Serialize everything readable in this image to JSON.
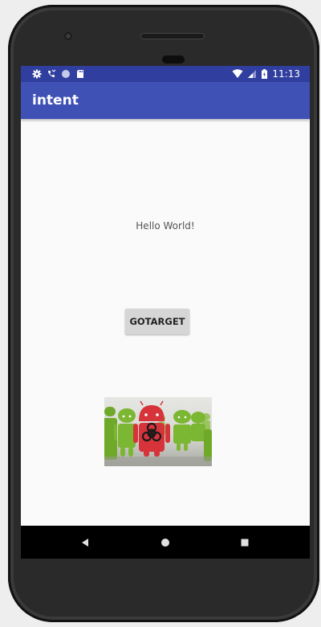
{
  "statusbar": {
    "time": "11:13"
  },
  "appbar": {
    "title": "intent"
  },
  "main": {
    "hello_text": "Hello World!",
    "button_label": "GOTARGET"
  },
  "colors": {
    "primary": "#3f51b5",
    "primary_dark": "#303f9f",
    "background": "#fafafa"
  },
  "icons": {
    "status_left": [
      "gear-icon",
      "missed-call-icon",
      "circle-icon",
      "sd-card-icon"
    ],
    "status_right": [
      "wifi-icon",
      "signal-icon",
      "battery-icon"
    ],
    "nav": [
      "back-icon",
      "home-icon",
      "recents-icon"
    ]
  }
}
